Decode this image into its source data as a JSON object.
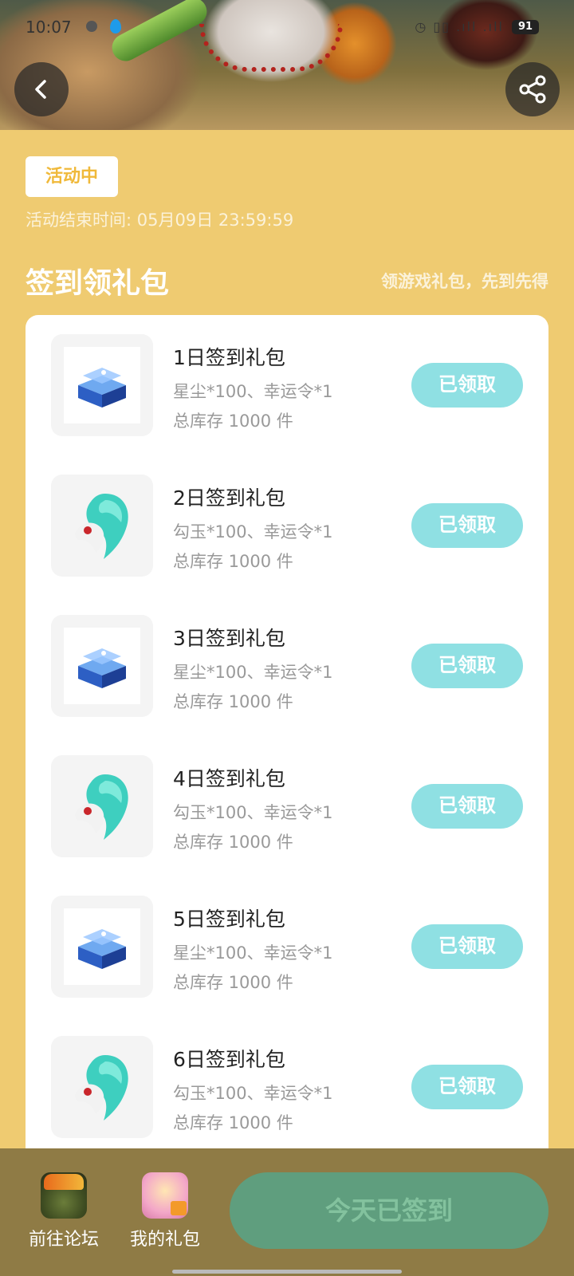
{
  "status_bar": {
    "time": "10:07",
    "right_icons": "◷ ▯▯ .ıll .ıll",
    "battery": "91"
  },
  "header": {
    "back_icon": "chevron-left-icon",
    "share_icon": "share-icon"
  },
  "activity": {
    "status_badge": "活动中",
    "end_time": "活动结束时间: 05月09日 23:59:59"
  },
  "section": {
    "title": "签到领礼包",
    "subtitle": "领游戏礼包，先到先得"
  },
  "gifts": [
    {
      "name": "1日签到礼包",
      "desc": "星尘*100、幸运令*1",
      "stock": "总库存 1000 件",
      "button": "已领取",
      "icon": "blue-chest-icon"
    },
    {
      "name": "2日签到礼包",
      "desc": "勾玉*100、幸运令*1",
      "stock": "总库存 1000 件",
      "button": "已领取",
      "icon": "jade-magatama-icon"
    },
    {
      "name": "3日签到礼包",
      "desc": "星尘*100、幸运令*1",
      "stock": "总库存 1000 件",
      "button": "已领取",
      "icon": "blue-chest-icon"
    },
    {
      "name": "4日签到礼包",
      "desc": "勾玉*100、幸运令*1",
      "stock": "总库存 1000 件",
      "button": "已领取",
      "icon": "jade-magatama-icon"
    },
    {
      "name": "5日签到礼包",
      "desc": "星尘*100、幸运令*1",
      "stock": "总库存 1000 件",
      "button": "已领取",
      "icon": "blue-chest-icon"
    },
    {
      "name": "6日签到礼包",
      "desc": "勾玉*100、幸运令*1",
      "stock": "总库存 1000 件",
      "button": "已领取",
      "icon": "jade-magatama-icon"
    }
  ],
  "bottom_bar": {
    "forum_label": "前往论坛",
    "my_gifts_label": "我的礼包",
    "signed_button": "今天已签到"
  },
  "colors": {
    "page_background": "#efcb71",
    "claimed_button": "#8fe0e3",
    "signed_button": "#5f9e7e",
    "bottom_bar": "#8f7b45"
  }
}
